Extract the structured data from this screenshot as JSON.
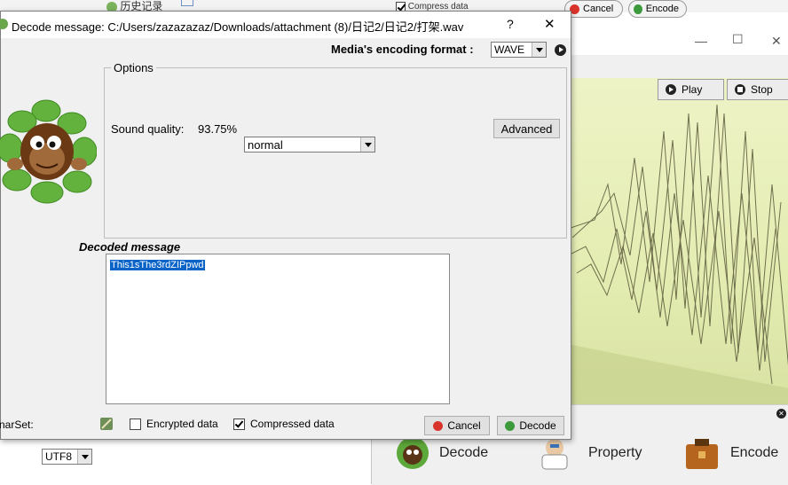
{
  "background": {
    "top_item_1": "历史记录",
    "top_item_2": "Compress data",
    "cancel_label": "Cancel",
    "encode_label": "Encode",
    "play_label": "Play",
    "stop_label": "Stop",
    "bottom_tools": [
      "Decode",
      "Property",
      "Encode"
    ]
  },
  "dialog": {
    "title": "Decode message: C:/Users/zazazazaz/Downloads/attachment (8)/日记2/日记2/打架.wav",
    "help_label": "?",
    "close_label": "✕",
    "encoding_format_label": "Media's encoding format :",
    "encoding_format_value": "WAVE",
    "options_legend": "Options",
    "sound_quality_label": "Sound quality:",
    "sound_quality_percent": "93.75%",
    "sound_quality_value": "normal",
    "advanced_label": "Advanced",
    "decoded_heading": "Decoded message",
    "decoded_text": "This1sThe3rdZIPpwd",
    "charset_label": "narSet:",
    "charset_value": "UTF8",
    "encrypted_label": "Encrypted data",
    "encrypted_checked": false,
    "compressed_label": "Compressed data",
    "compressed_checked": true,
    "cancel_label": "Cancel",
    "decode_label": "Decode"
  },
  "colors": {
    "selection": "#0a64c8",
    "wave_bg": "#e3ecb0",
    "cancel_icon": "#d9342b",
    "ok_icon": "#3c9a3c"
  }
}
